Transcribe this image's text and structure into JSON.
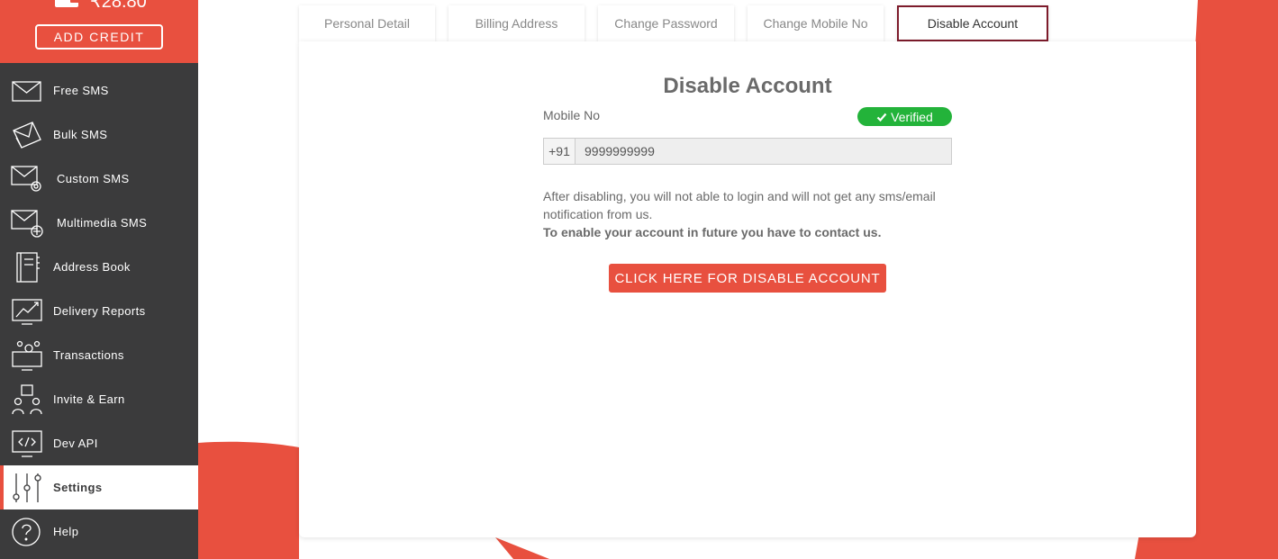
{
  "sidebar": {
    "balance": "₹28.80",
    "add_credit_label": "ADD CREDIT",
    "items": [
      {
        "label": "Free SMS",
        "icon": "envelope-icon"
      },
      {
        "label": "Bulk SMS",
        "icon": "envelopes-stack-icon"
      },
      {
        "label": "Custom SMS",
        "icon": "envelope-gear-icon"
      },
      {
        "label": "Multimedia SMS",
        "icon": "envelope-plus-icon"
      },
      {
        "label": "Address Book",
        "icon": "address-book-icon"
      },
      {
        "label": "Delivery Reports",
        "icon": "chart-monitor-icon"
      },
      {
        "label": "Transactions",
        "icon": "transactions-monitor-icon"
      },
      {
        "label": "Invite & Earn",
        "icon": "invite-people-icon"
      },
      {
        "label": "Dev API",
        "icon": "code-monitor-icon"
      },
      {
        "label": "Settings",
        "icon": "sliders-icon",
        "active": true
      },
      {
        "label": "Help",
        "icon": "help-circle-icon"
      }
    ]
  },
  "tabs": [
    {
      "label": "Personal Detail"
    },
    {
      "label": "Billing Address"
    },
    {
      "label": "Change Password"
    },
    {
      "label": "Change Mobile No"
    },
    {
      "label": "Disable Account",
      "active": true
    }
  ],
  "main": {
    "title": "Disable Account",
    "mobile_label": "Mobile No",
    "verified_label": "Verified",
    "country_code": "+91",
    "mobile_value": "9999999999",
    "info_text": "After disabling, you will not able to login and will not get any sms/email notification from us.",
    "info_bold": "To enable your account in future you have to contact us.",
    "disable_button_label": "CLICK HERE FOR DISABLE ACCOUNT"
  },
  "colors": {
    "brand_red": "#e8503f",
    "sidebar_dark": "#3b3b3c",
    "active_tab_border": "#7d1b2b",
    "verified_green": "#23b33a"
  }
}
